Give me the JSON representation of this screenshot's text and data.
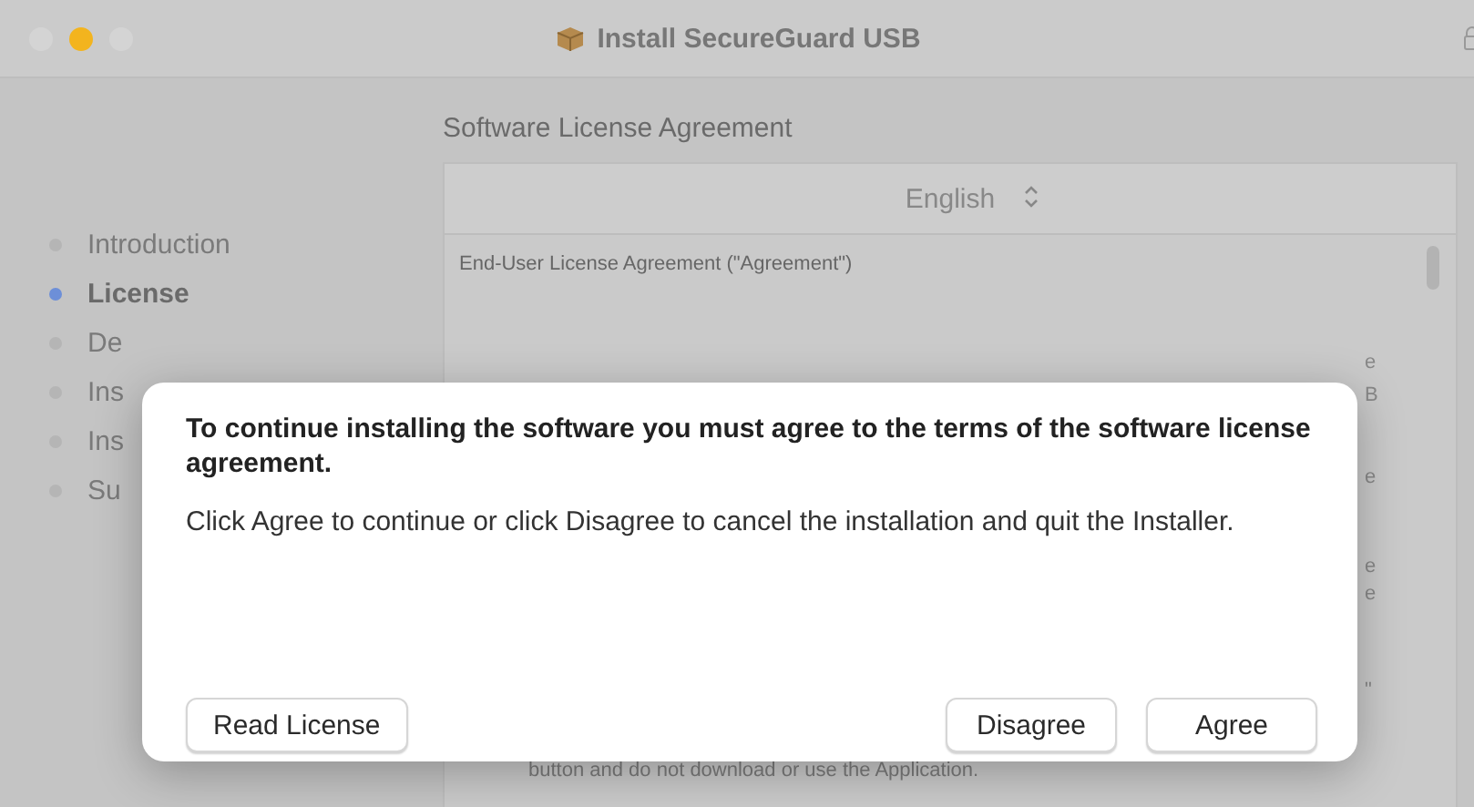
{
  "window": {
    "title": "Install SecureGuard USB"
  },
  "sidebar": {
    "items": [
      {
        "label": "Introduction",
        "selected": false
      },
      {
        "label": "License",
        "selected": true
      },
      {
        "label": "De",
        "selected": false
      },
      {
        "label": "Ins",
        "selected": false
      },
      {
        "label": "Ins",
        "selected": false
      },
      {
        "label": "Su",
        "selected": false
      }
    ]
  },
  "content": {
    "heading": "Software License Agreement",
    "language": "English",
    "license_title": "End-User License Agreement (\"Agreement\")",
    "license_fragments": [
      "e",
      "B",
      "e",
      "e",
      "e",
      "\""
    ],
    "license_last_line": "button and do not download or use the Application."
  },
  "dialog": {
    "title": "To continue installing the software you must agree to the terms of the software license agreement.",
    "message": "Click Agree to continue or click Disagree to cancel the installation and quit the Installer.",
    "buttons": [
      {
        "label": "Read License",
        "kind": "left"
      },
      {
        "label": "Disagree",
        "kind": "right"
      },
      {
        "label": "Agree",
        "kind": "right"
      }
    ]
  }
}
